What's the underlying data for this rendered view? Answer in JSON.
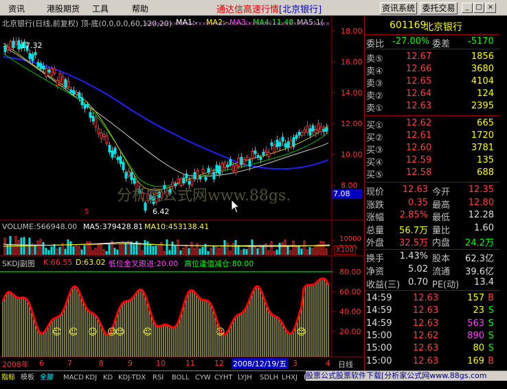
{
  "menu": {
    "items": [
      "资讯",
      "港股期货",
      "工具",
      "帮助"
    ],
    "title_main": "通达信高速行情",
    "title_sub": "[北京银行]",
    "btn_info": "资讯系统",
    "btn_trade": "委托交易",
    "win_min": "_",
    "win_max": "□",
    "win_close": "×"
  },
  "chart": {
    "header": "北京银行(日线,前复权) 顶-底(0,0,0,0,60,120,20)",
    "ma1": "MA1:-",
    "ma2": "MA2:-",
    "ma3": "MA3:-",
    "ma4": "MA4:11.48",
    "ma5": "MA5:1(",
    "high_label": "17.32",
    "low_label": "6.42",
    "s_marker": "S",
    "price_ticks": [
      "18.00",
      "16.00",
      "14.00",
      "12.00",
      "10.00",
      "8.00"
    ],
    "current_tag": "7.08",
    "watermark": "分析家公式网www.88gs.",
    "vol_header": "VOLUME:566948.00",
    "vol_ma5": "MA5:379428.81",
    "vol_ma10": "MA10:453138.41",
    "vol_ticks": [
      "10000",
      "5000"
    ],
    "vol_unit": "X100",
    "kdj_title": "SKDJ副图",
    "kdj_k": "K:66.55",
    "kdj_d": "D:63.02",
    "kdj_buy": "低位金叉跟进:20.00",
    "kdj_sell": "高位逢值减仓:80.00",
    "kdj_ticks": [
      "80.00",
      "60.00",
      "40.00",
      "20.00"
    ]
  },
  "dates": {
    "labels": [
      "2008年",
      "6",
      "7",
      "8",
      "9",
      "10",
      "11",
      "12",
      "2008/12/19/五",
      "3",
      "4"
    ],
    "axis_unit": "日线"
  },
  "panel": {
    "code": "601169",
    "name": "北京银行",
    "weibi_label": "委比",
    "weibi_value": "-27.00%",
    "weicha_label": "委差",
    "weicha_value": "-5170",
    "sell": [
      {
        "label": "卖⑤",
        "price": "12.67",
        "vol": "1856"
      },
      {
        "label": "卖④",
        "price": "12.66",
        "vol": "3680"
      },
      {
        "label": "卖③",
        "price": "12.65",
        "vol": "4104"
      },
      {
        "label": "卖②",
        "price": "12.64",
        "vol": "124"
      },
      {
        "label": "卖①",
        "price": "12.63",
        "vol": "2395"
      }
    ],
    "buy": [
      {
        "label": "买①",
        "price": "12.62",
        "vol": "665"
      },
      {
        "label": "买②",
        "price": "12.61",
        "vol": "1720"
      },
      {
        "label": "买③",
        "price": "12.60",
        "vol": "3781"
      },
      {
        "label": "买④",
        "price": "12.59",
        "vol": "135"
      },
      {
        "label": "买⑤",
        "price": "12.58",
        "vol": "688"
      }
    ],
    "stats": [
      {
        "l1": "现价",
        "v1": "12.63",
        "l2": "今开",
        "v2": "12.35",
        "c1": "#ff4040",
        "c2": "#ff4040"
      },
      {
        "l1": "涨跌",
        "v1": "0.35",
        "l2": "最高",
        "v2": "12.80",
        "c1": "#ff4040",
        "c2": "#ff4040"
      },
      {
        "l1": "涨幅",
        "v1": "2.85%",
        "l2": "最低",
        "v2": "12.28",
        "c1": "#ff4040",
        "c2": "#e0e0e0"
      },
      {
        "l1": "总量",
        "v1": "56.7万",
        "l2": "量比",
        "v2": "1.60",
        "c1": "#ffff00",
        "c2": "#e0e0e0"
      },
      {
        "l1": "外盘",
        "v1": "32.5万",
        "l2": "内盘",
        "v2": "24.2万",
        "c1": "#ff4040",
        "c2": "#00ff00"
      }
    ],
    "stats2": [
      {
        "l1": "换手",
        "v1": "1.43%",
        "l2": "股本",
        "v2": "62.3亿"
      },
      {
        "l1": "净资",
        "v1": "5.02",
        "l2": "流通",
        "v2": "39.6亿"
      },
      {
        "l1": "收益(三)",
        "v1": "0.70",
        "l2": "PE(动)",
        "v2": "13.4"
      }
    ],
    "ticks": [
      {
        "time": "14:59",
        "price": "12.63",
        "vol": "157",
        "side": "B",
        "pc": "#ff4040",
        "vc": "#ffff00",
        "sc": "#ff4040"
      },
      {
        "time": "14:59",
        "price": "12.63",
        "vol": "23",
        "side": "S",
        "pc": "#ff4040",
        "vc": "#ffff00",
        "sc": "#00ff00"
      },
      {
        "time": "14:59",
        "price": "12.63",
        "vol": "563",
        "side": "S",
        "pc": "#ff4040",
        "vc": "#ff40ff",
        "sc": "#00ff00"
      },
      {
        "time": "15:00",
        "price": "12.62",
        "vol": "890",
        "side": "S",
        "pc": "#ff4040",
        "vc": "#ff40ff",
        "sc": "#00ff00"
      },
      {
        "time": "15:00",
        "price": "12.63",
        "vol": "80",
        "side": "S",
        "pc": "#ff4040",
        "vc": "#ffff00",
        "sc": "#00ff00"
      },
      {
        "time": "15:00",
        "price": "12.63",
        "vol": "169",
        "side": "B",
        "pc": "#ff4040",
        "vc": "#ffff00",
        "sc": "#ff4040"
      }
    ]
  },
  "tabs": [
    "指标",
    "模板",
    "全部",
    "MACD",
    "KDJ",
    "KD",
    "KDJ-TDX",
    "RSI",
    "BOLL",
    "CYW",
    "CYHT",
    "LYJH",
    "SDLH",
    "LHXJ",
    "B"
  ],
  "footer_ad": "股票公式股票软件下载[分析家公式网www.88gs.com"
}
